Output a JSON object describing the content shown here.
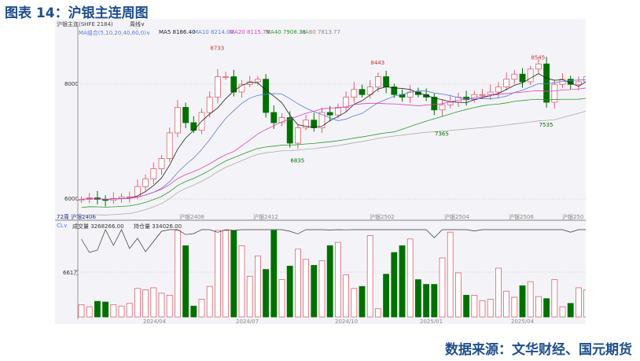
{
  "title": "图表 14：沪银主连周图",
  "source": "数据来源：文华财经、国元期货",
  "toolbar": {
    "symbol": "沪银主连(SHFE 2184)",
    "period": "周线∨"
  },
  "ma_legend": {
    "group": "MA组合(5,10,20,40,60,0)∨",
    "ma5": "MA5 8186.40",
    "ma10": "MA10 8214.00",
    "ma20": "MA20 8115.75",
    "ma40": "MA40 7908.38",
    "ma60": "MA60 7813.77"
  },
  "colors": {
    "up": "#e06070",
    "down": "#007000",
    "ma5": "#222222",
    "ma10": "#5a7ae0",
    "ma20": "#e040c0",
    "ma40": "#2a9a2a",
    "ma60": "#aaaaaa"
  },
  "annotations": [
    {
      "text": "8733",
      "v": 8733,
      "i": 17,
      "c": "#d03030"
    },
    {
      "text": "6835",
      "v": 6835,
      "i": 27,
      "c": "#007000"
    },
    {
      "text": "8443",
      "v": 8443,
      "i": 37,
      "c": "#d03030"
    },
    {
      "text": "7365",
      "v": 7365,
      "i": 45,
      "c": "#007000"
    },
    {
      "text": "8545",
      "v": 8545,
      "i": 57,
      "c": "#d03030"
    },
    {
      "text": "7535",
      "v": 7535,
      "i": 58,
      "c": "#007000"
    }
  ],
  "price_axis": [
    "8000",
    "6000"
  ],
  "contract_labels": [
    "72周 沪银2406",
    "沪银2408",
    "沪银2412",
    "沪银2502",
    "沪银2504",
    "沪银2506",
    "沪银250"
  ],
  "volume_legend": {
    "cl": "CL∨",
    "volume": "成交量 3268266.00",
    "oi": "持仓量 334026.00",
    "ref": "661万"
  },
  "date_labels": [
    "2024/04",
    "2024/07",
    "2024/10",
    "2025/01",
    "2025/04"
  ],
  "chart_data": {
    "type": "candlestick",
    "period": "weekly",
    "close": [
      5900,
      5930,
      5900,
      5880,
      5920,
      5950,
      5950,
      6150,
      6300,
      6500,
      6700,
      7200,
      7700,
      7400,
      7250,
      7600,
      7900,
      8300,
      8300,
      8000,
      8150,
      8200,
      8250,
      7600,
      7400,
      7500,
      7000,
      7300,
      7450,
      7300,
      7600,
      7550,
      7700,
      7900,
      8050,
      7950,
      8100,
      8300,
      8100,
      7950,
      7900,
      8000,
      7950,
      7900,
      7650,
      7750,
      7800,
      7900,
      7850,
      7950,
      7950,
      8000,
      8100,
      8250,
      8350,
      8200,
      8450,
      8550,
      7800,
      8150,
      8250,
      8150,
      8200,
      8300
    ],
    "volume_wan": [
      180,
      150,
      230,
      220,
      180,
      160,
      200,
      420,
      400,
      430,
      350,
      320,
      1500,
      1050,
      160,
      260,
      450,
      1300,
      1400,
      1400,
      1050,
      600,
      900,
      700,
      1500,
      550,
      750,
      1000,
      850,
      760,
      830,
      1050,
      1100,
      620,
      420,
      450,
      1200,
      120,
      630,
      950,
      1050,
      1150,
      550,
      480,
      480,
      870,
      1250,
      650,
      320,
      320,
      240,
      260,
      720,
      380,
      290,
      460,
      520,
      300,
      270,
      550,
      150,
      200,
      430,
      400
    ]
  }
}
